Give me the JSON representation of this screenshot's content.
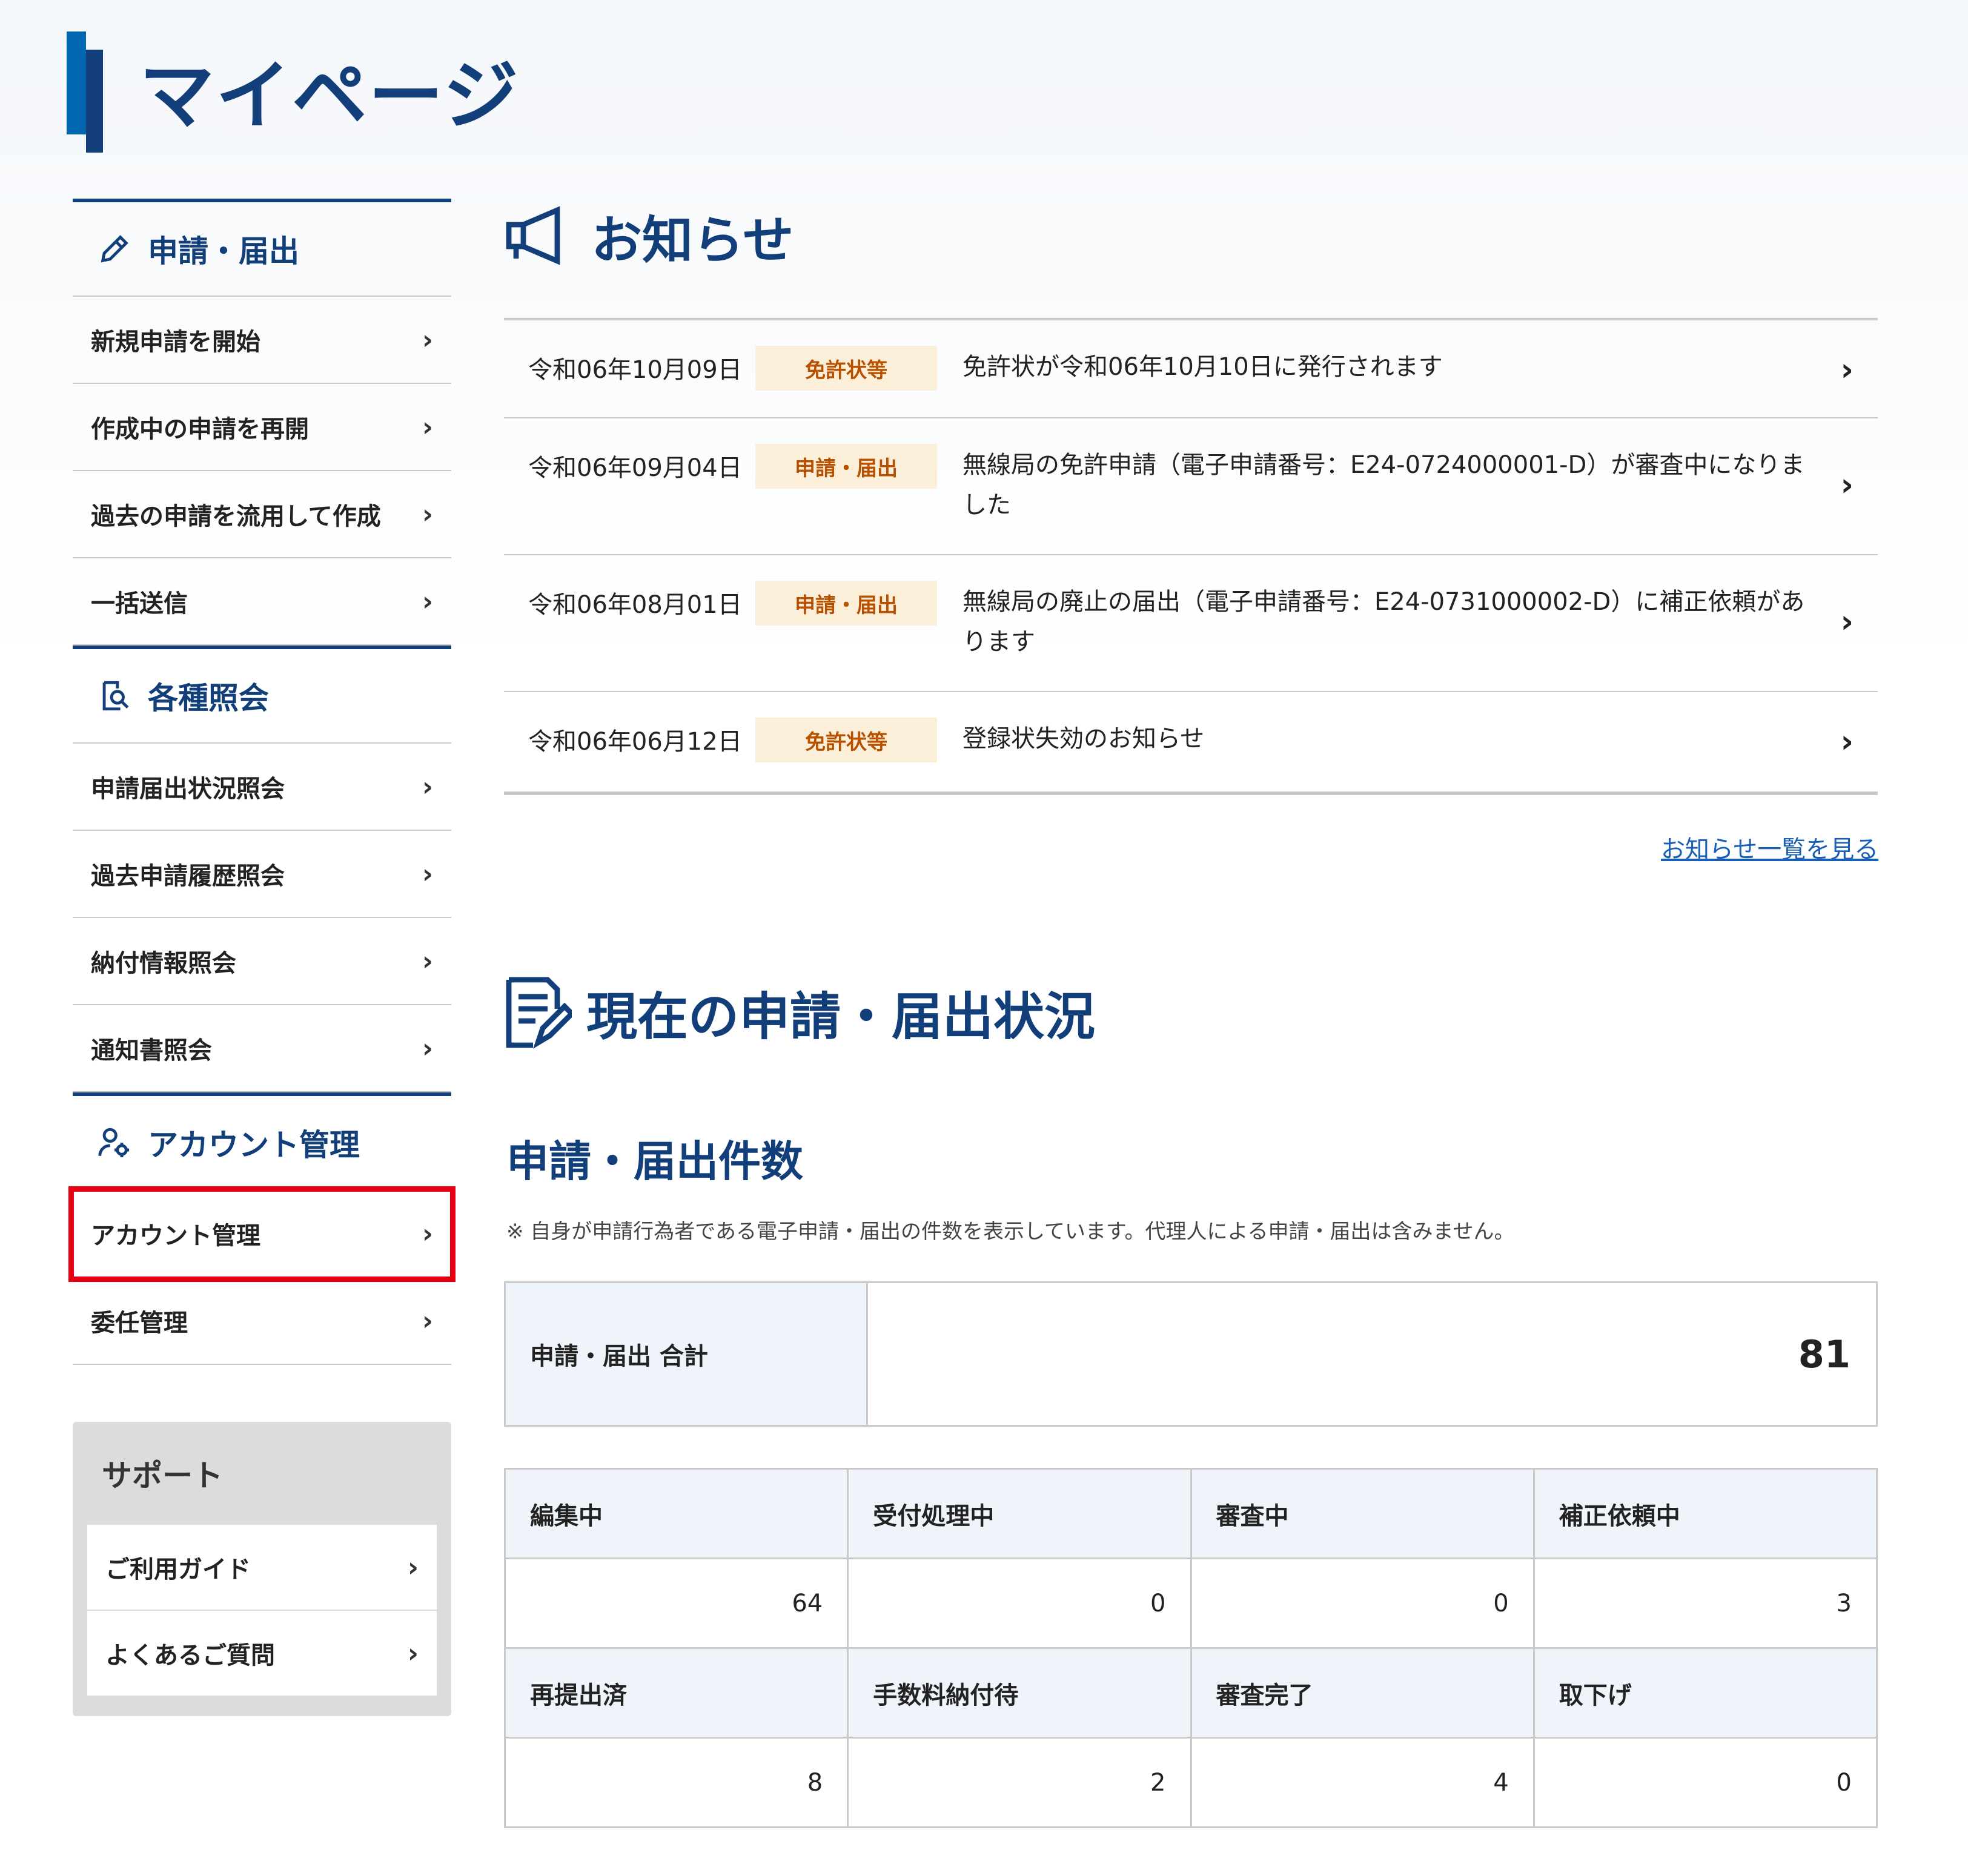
{
  "page": {
    "title": "マイページ"
  },
  "sidebar": {
    "sections": [
      {
        "title": "申請・届出",
        "icon": "pencil-icon",
        "items": [
          "新規申請を開始",
          "作成中の申請を再開",
          "過去の申請を流用して作成",
          "一括送信"
        ]
      },
      {
        "title": "各種照会",
        "icon": "document-search-icon",
        "items": [
          "申請届出状況照会",
          "過去申請履歴照会",
          "納付情報照会",
          "通知書照会"
        ]
      },
      {
        "title": "アカウント管理",
        "icon": "user-gear-icon",
        "items": [
          "アカウント管理",
          "委任管理"
        ]
      }
    ],
    "support": {
      "title": "サポート",
      "items": [
        "ご利用ガイド",
        "よくあるご質問"
      ]
    }
  },
  "news": {
    "title": "お知らせ",
    "items": [
      {
        "date": "令和06年10月09日",
        "tag": "免許状等",
        "text": "免許状が令和06年10月10日に発行されます"
      },
      {
        "date": "令和06年09月04日",
        "tag": "申請・届出",
        "text": "無線局の免許申請（電子申請番号：E24-0724000001-D）が審査中になりました"
      },
      {
        "date": "令和06年08月01日",
        "tag": "申請・届出",
        "text": "無線局の廃止の届出（電子申請番号：E24-0731000002-D）に補正依頼があります"
      },
      {
        "date": "令和06年06月12日",
        "tag": "免許状等",
        "text": "登録状失効のお知らせ"
      }
    ],
    "all_link": "お知らせ一覧を見る"
  },
  "status": {
    "title": "現在の申請・届出状況",
    "subtitle": "申請・届出件数",
    "note": "※ 自身が申請行為者である電子申請・届出の件数を表示しています。代理人による申請・届出は含みません。",
    "total_label": "申請・届出 合計",
    "total_value": "81",
    "rows": [
      {
        "headers": [
          "編集中",
          "受付処理中",
          "審査中",
          "補正依頼中"
        ],
        "values": [
          "64",
          "0",
          "0",
          "3"
        ]
      },
      {
        "headers": [
          "再提出済",
          "手数料納付待",
          "審査完了",
          "取下げ"
        ],
        "values": [
          "8",
          "2",
          "4",
          "0"
        ]
      }
    ]
  },
  "colors": {
    "navy": "#123e79",
    "blue": "#0067b0",
    "tag_bg": "#fbefd9",
    "tag_text": "#b85000",
    "highlight": "#e60012",
    "link": "#1a5fb4"
  }
}
